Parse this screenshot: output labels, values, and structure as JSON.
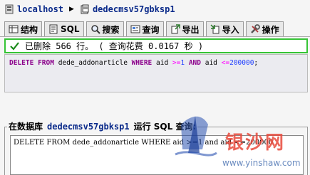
{
  "breadcrumb": {
    "server": "localhost",
    "database": "dedecmsv57gbksp1"
  },
  "tabs": [
    {
      "label": "结构",
      "icon": "structure-icon"
    },
    {
      "label": "SQL",
      "icon": "sql-icon"
    },
    {
      "label": "搜索",
      "icon": "search-icon"
    },
    {
      "label": "查询",
      "icon": "query-icon"
    },
    {
      "label": "导出",
      "icon": "export-icon"
    },
    {
      "label": "导入",
      "icon": "import-icon"
    },
    {
      "label": "操作",
      "icon": "operations-icon"
    }
  ],
  "notice": {
    "text": "已删除 566 行。 ( 查询花费 0.0167 秒 )"
  },
  "sql_display": {
    "kw_delete": "DELETE",
    "kw_from": "FROM",
    "table": "dede_addonarticle",
    "kw_where": "WHERE",
    "col1": "aid",
    "op1": ">=",
    "val1": "1",
    "kw_and": "AND",
    "col2": "aid",
    "op2": "<=",
    "val2": "200000",
    "end": ";"
  },
  "run_query": {
    "prefix": "在数据库",
    "database": "dedecmsv57gbksp1",
    "suffix": "运行 SQL 查询:",
    "sql_text": "DELETE FROM dede_addonarticle WHERE aid >=1 and aid <=200000"
  },
  "watermark": {
    "brand": "银沙网",
    "url": "www.yinshaw.com"
  },
  "colors": {
    "notice_border": "#36c436",
    "keyword": "#8b008b",
    "number": "#1a3aff",
    "operator": "#ff00ff"
  }
}
